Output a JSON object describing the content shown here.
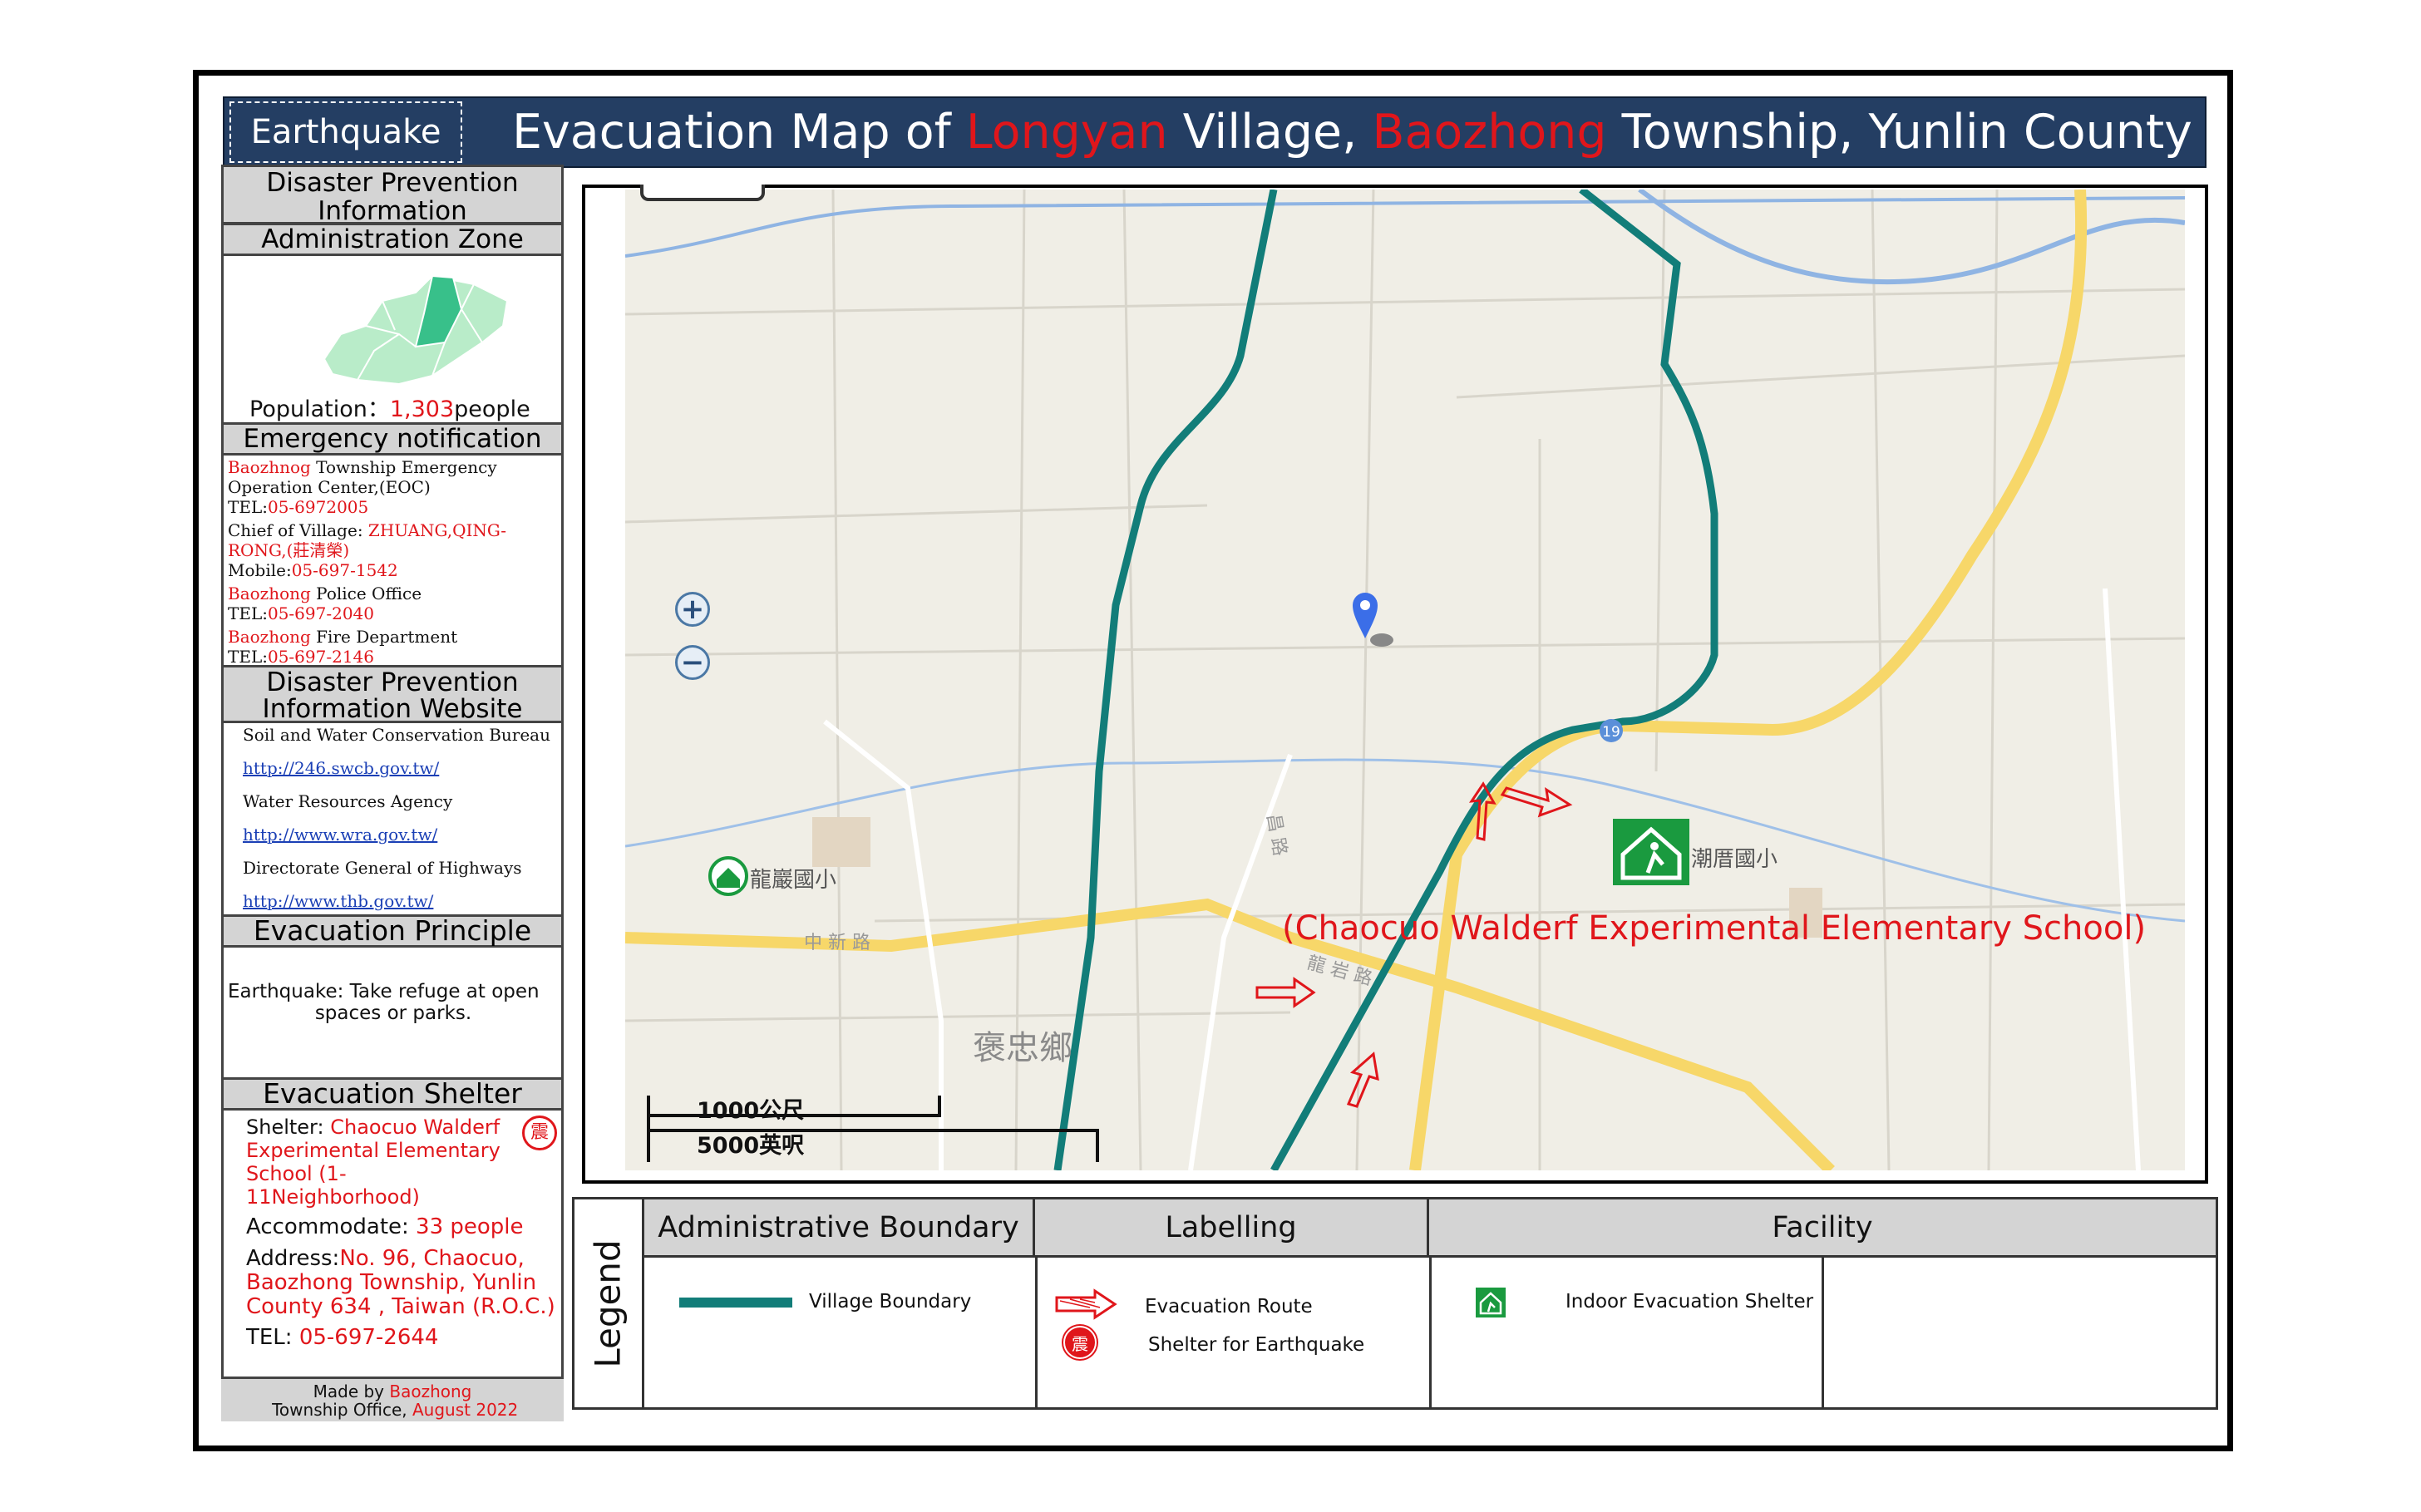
{
  "header": {
    "hazard_tag": "Earthquake",
    "title_pre": "Evacuation Map of ",
    "title_village": "Longyan",
    "title_mid": " Village, ",
    "title_township": "Baozhong",
    "title_post": " Township, Yunlin County"
  },
  "sidebar": {
    "dp_info": "Disaster Prevention Information",
    "admin_zone": "Administration Zone",
    "population_label": "Population：",
    "population_value": "1,303",
    "population_unit": "people",
    "emergency_title": "Emergency notification",
    "contacts": [
      {
        "name_red": "Baozhnog",
        "name_rest": " Township Emergency Operation Center,(EOC)",
        "tel_label": "TEL:",
        "tel": "05-6972005"
      },
      {
        "name_rest": "Chief of Village: ",
        "name_red": "ZHUANG,QING-RONG,(莊清榮)",
        "tel_label": "Mobile:",
        "tel": "05-697-1542"
      },
      {
        "name_red": "Baozhong",
        "name_rest": " Police Office",
        "tel_label": "TEL:",
        "tel": "05-697-2040"
      },
      {
        "name_red": "Baozhong",
        "name_rest": " Fire Department",
        "tel_label": "TEL:",
        "tel": "05-697-2146"
      }
    ],
    "website_title": "Disaster Prevention Information Website",
    "websites": [
      {
        "org": "Soil and Water Conservation Bureau",
        "url": "http://246.swcb.gov.tw/"
      },
      {
        "org": "Water Resources Agency",
        "url": "http://www.wra.gov.tw/"
      },
      {
        "org": "Directorate General of Highways",
        "url": "http://www.thb.gov.tw/"
      }
    ],
    "principle_title": "Evacuation Principle",
    "principle_text_1": "Earthquake: Take refuge at open",
    "principle_text_2": "spaces or parks.",
    "shelter_title": "Evacuation Shelter",
    "shelter_label": "Shelter: ",
    "shelter_name": "Chaocuo Walderf Experimental Elementary School (1-11Neighborhood)",
    "accommodate_label": "Accommodate: ",
    "accommodate_value": "33 people",
    "address_label": "Address:",
    "address_value": "No. 96, Chaocuo, Baozhong Township, Yunlin County 634 , Taiwan (R.O.C.)",
    "tel_label": "TEL: ",
    "tel_value": "05-697-2644",
    "made_by_pre": "Made by ",
    "made_by_red": "Baozhong",
    "made_by_post": " Township Office, ",
    "made_date": "August 2022"
  },
  "map": {
    "school_label": "(Chaocuo Walderf Experimental Elementary School)",
    "shelter_map_label": "潮厝國小",
    "longyan_school": "龍巖國小",
    "road_zhongxin": "中 新 路",
    "road_longyan": "龍 岩 路",
    "road_vertical": "昌 路",
    "township_label": "褒忠鄉",
    "route_number": "19",
    "scale_top": "1000公尺",
    "scale_bottom": "5000英呎",
    "zoom_in": "+",
    "zoom_out": "−"
  },
  "legend": {
    "title": "Legend",
    "col1_header": "Administrative Boundary",
    "col2_header": "Labelling",
    "col3_header": "Facility",
    "boundary_label": "Village Boundary",
    "route_label": "Evacuation Route",
    "shelter_eq_label": "Shelter for Earthquake",
    "shelter_eq_icon": "震",
    "indoor_label": "Indoor Evacuation Shelter"
  },
  "colors": {
    "title_bar": "#243e63",
    "accent_red": "#e0161b",
    "boundary": "#127d79",
    "road_major": "#f7d769",
    "river": "#8fb4e3",
    "shelter_green": "#1a9a3f"
  }
}
